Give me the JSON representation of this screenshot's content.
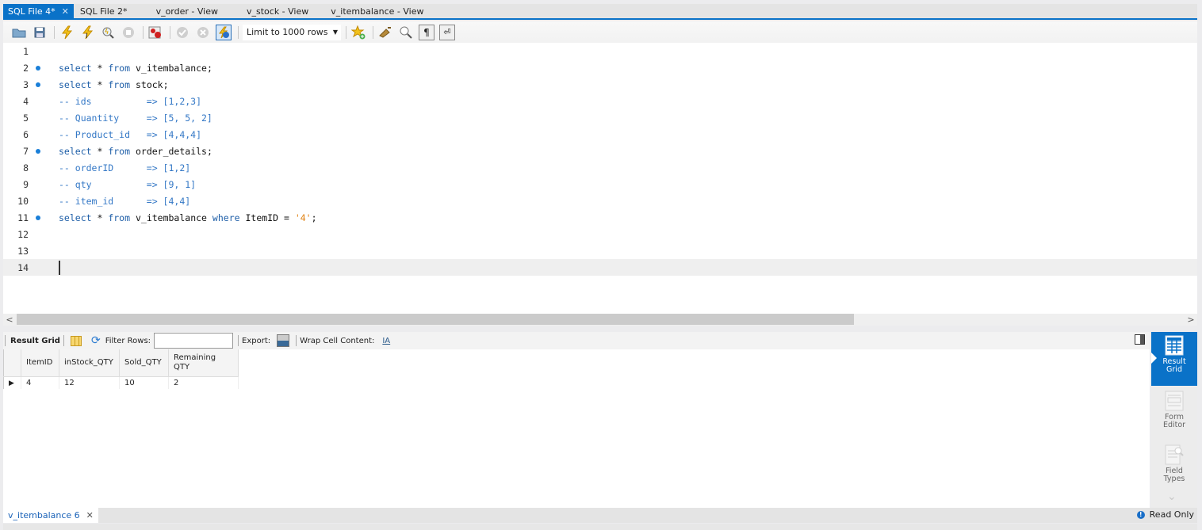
{
  "tabs": [
    {
      "label": "SQL File 4*",
      "active": true,
      "closable": true
    },
    {
      "label": "SQL File 2*"
    },
    {
      "label": "v_order - View"
    },
    {
      "label": "v_stock - View"
    },
    {
      "label": "v_itembalance - View"
    }
  ],
  "toolbar": {
    "icons": [
      "open-folder-icon",
      "save-icon",
      "execute-icon",
      "execute-current-icon",
      "explain-icon",
      "stop-icon",
      "toggle-error-icon",
      "commit-icon",
      "rollback-icon",
      "autocommit-icon"
    ],
    "limit_label": "Limit to 1000 rows",
    "right_icons": [
      "add-snippet-icon",
      "beautify-icon",
      "find-icon",
      "invisible-chars-icon",
      "wrap-icon"
    ]
  },
  "editor": {
    "lines": [
      {
        "num": "1",
        "marker": false,
        "text": ""
      },
      {
        "num": "2",
        "marker": true,
        "text": "select * from v_itembalance;"
      },
      {
        "num": "3",
        "marker": true,
        "text": "select * from stock;"
      },
      {
        "num": "4",
        "marker": false,
        "text": "-- ids          => [1,2,3]"
      },
      {
        "num": "5",
        "marker": false,
        "text": "-- Quantity     => [5, 5, 2]"
      },
      {
        "num": "6",
        "marker": false,
        "text": "-- Product_id   => [4,4,4]"
      },
      {
        "num": "7",
        "marker": true,
        "text": "select * from order_details;"
      },
      {
        "num": "8",
        "marker": false,
        "text": "-- orderID      => [1,2]"
      },
      {
        "num": "9",
        "marker": false,
        "text": "-- qty          => [9, 1]"
      },
      {
        "num": "10",
        "marker": false,
        "text": "-- item_id      => [4,4]"
      },
      {
        "num": "11",
        "marker": true,
        "text": "select * from v_itembalance where ItemID = '4';"
      },
      {
        "num": "12",
        "marker": false,
        "text": ""
      },
      {
        "num": "13",
        "marker": false,
        "text": ""
      },
      {
        "num": "14",
        "marker": false,
        "text": "",
        "current": true
      }
    ]
  },
  "result_toolbar": {
    "result_grid_label": "Result Grid",
    "filter_label": "Filter Rows:",
    "filter_value": "",
    "export_label": "Export:",
    "wrap_label": "Wrap Cell Content:"
  },
  "grid": {
    "columns": [
      "ItemID",
      "inStock_QTY",
      "Sold_QTY",
      "Remaining QTY"
    ],
    "rows": [
      [
        "4",
        "12",
        "10",
        "2"
      ]
    ]
  },
  "side_panel": {
    "items": [
      {
        "label": "Result Grid",
        "active": true
      },
      {
        "label": "Form Editor"
      },
      {
        "label": "Field Types"
      }
    ]
  },
  "bottom": {
    "tab_label": "v_itembalance 6",
    "status": "Read Only"
  }
}
